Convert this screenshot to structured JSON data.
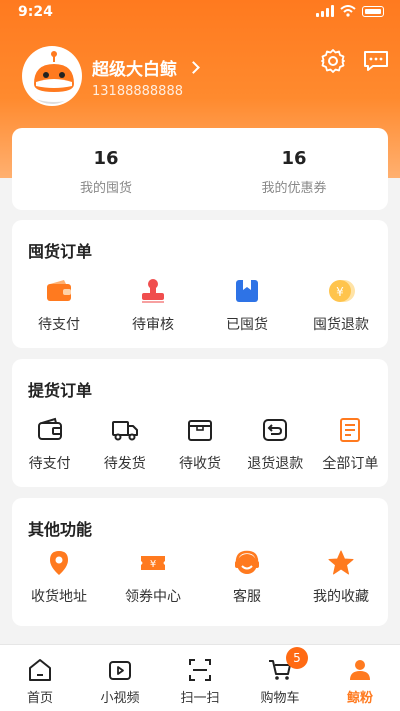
{
  "status_bar": {
    "time": "9:24"
  },
  "profile": {
    "name": "超级大白鲸",
    "phone": "13188888888"
  },
  "stats": [
    {
      "value": "16",
      "label": "我的囤货"
    },
    {
      "value": "16",
      "label": "我的优惠券"
    }
  ],
  "sections": [
    {
      "title": "囤货订单",
      "items": [
        {
          "label": "待支付",
          "icon": "wallet-icon"
        },
        {
          "label": "待审核",
          "icon": "stamp-icon"
        },
        {
          "label": "已囤货",
          "icon": "bookmark-box-icon"
        },
        {
          "label": "囤货退款",
          "icon": "coin-icon"
        }
      ]
    },
    {
      "title": "提货订单",
      "items": [
        {
          "label": "待支付",
          "icon": "wallet-outline-icon"
        },
        {
          "label": "待发货",
          "icon": "truck-icon"
        },
        {
          "label": "待收货",
          "icon": "box-icon"
        },
        {
          "label": "退货退款",
          "icon": "return-icon"
        },
        {
          "label": "全部订单",
          "icon": "document-icon"
        }
      ]
    },
    {
      "title": "其他功能",
      "items": [
        {
          "label": "收货地址",
          "icon": "location-pin-icon"
        },
        {
          "label": "领券中心",
          "icon": "coupon-icon"
        },
        {
          "label": "客服",
          "icon": "headset-icon"
        },
        {
          "label": "我的收藏",
          "icon": "star-icon"
        }
      ]
    }
  ],
  "tabbar": {
    "items": [
      {
        "label": "首页",
        "icon": "home-icon"
      },
      {
        "label": "小视频",
        "icon": "video-icon"
      },
      {
        "label": "扫一扫",
        "icon": "scan-icon"
      },
      {
        "label": "购物车",
        "icon": "cart-icon",
        "badge": "5"
      },
      {
        "label": "鲸粉",
        "icon": "person-icon",
        "active": true
      }
    ]
  },
  "colors": {
    "accent": "#ff7a1f",
    "badge": "#ff6a13",
    "red": "#f04e4e",
    "blue": "#2e73e6"
  }
}
